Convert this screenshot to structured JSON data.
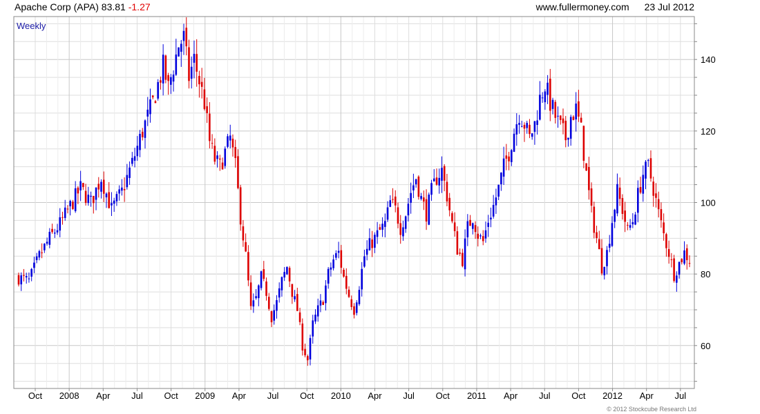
{
  "header": {
    "name": "Apache Corp (APA)",
    "price": "83.81",
    "change": "-1.27",
    "site": "www.fullermoney.com",
    "date": "23 Jul 2012"
  },
  "footer": {
    "copyright": "© 2012 Stockcube Research Ltd"
  },
  "colors": {
    "up": "#0000dd",
    "down": "#dd0000",
    "grid": "#dddddd",
    "frame": "#888888",
    "period_label": "#1a1aa6"
  },
  "chart_data": {
    "type": "candlestick",
    "period_label": "Weekly",
    "ylim": [
      48,
      152
    ],
    "yticks": [
      60,
      80,
      100,
      120,
      140
    ],
    "x_tick_labels": [
      "Oct",
      "2008",
      "Apr",
      "Jul",
      "Oct",
      "2009",
      "Apr",
      "Jul",
      "Oct",
      "2010",
      "Apr",
      "Jul",
      "Oct",
      "2011",
      "Apr",
      "Jul",
      "Oct",
      "2012",
      "Apr",
      "Jul"
    ],
    "series_close": [
      [
        0,
        79
      ],
      [
        4,
        78
      ],
      [
        8,
        85
      ],
      [
        12,
        90
      ],
      [
        16,
        94
      ],
      [
        20,
        99
      ],
      [
        24,
        104
      ],
      [
        28,
        100
      ],
      [
        32,
        107
      ],
      [
        36,
        98
      ],
      [
        40,
        103
      ],
      [
        44,
        111
      ],
      [
        48,
        120
      ],
      [
        52,
        128
      ],
      [
        56,
        138
      ],
      [
        58,
        132
      ],
      [
        62,
        144
      ],
      [
        64,
        146
      ],
      [
        66,
        135
      ],
      [
        68,
        140
      ],
      [
        70,
        134
      ],
      [
        72,
        128
      ],
      [
        74,
        117
      ],
      [
        76,
        112
      ],
      [
        78,
        110
      ],
      [
        80,
        114
      ],
      [
        82,
        118
      ],
      [
        84,
        110
      ],
      [
        86,
        96
      ],
      [
        88,
        85
      ],
      [
        90,
        70
      ],
      [
        92,
        73
      ],
      [
        94,
        79
      ],
      [
        96,
        75
      ],
      [
        98,
        68
      ],
      [
        100,
        72
      ],
      [
        102,
        78
      ],
      [
        104,
        82
      ],
      [
        106,
        75
      ],
      [
        108,
        70
      ],
      [
        110,
        60
      ],
      [
        112,
        56
      ],
      [
        114,
        66
      ],
      [
        116,
        70
      ],
      [
        118,
        73
      ],
      [
        120,
        80
      ],
      [
        122,
        84
      ],
      [
        124,
        86
      ],
      [
        126,
        79
      ],
      [
        128,
        74
      ],
      [
        130,
        70
      ],
      [
        132,
        77
      ],
      [
        134,
        85
      ],
      [
        136,
        88
      ],
      [
        138,
        90
      ],
      [
        140,
        92
      ],
      [
        142,
        94
      ],
      [
        144,
        100
      ],
      [
        146,
        98
      ],
      [
        148,
        93
      ],
      [
        150,
        97
      ],
      [
        152,
        103
      ],
      [
        154,
        107
      ],
      [
        156,
        101
      ],
      [
        158,
        97
      ],
      [
        160,
        103
      ],
      [
        162,
        107
      ],
      [
        164,
        109
      ],
      [
        166,
        102
      ],
      [
        168,
        94
      ],
      [
        170,
        87
      ],
      [
        172,
        84
      ],
      [
        174,
        93
      ],
      [
        176,
        96
      ],
      [
        178,
        91
      ],
      [
        180,
        89
      ],
      [
        182,
        95
      ],
      [
        184,
        99
      ],
      [
        186,
        104
      ],
      [
        188,
        110
      ],
      [
        190,
        114
      ],
      [
        192,
        120
      ],
      [
        194,
        125
      ],
      [
        196,
        122
      ],
      [
        198,
        118
      ],
      [
        200,
        122
      ],
      [
        202,
        129
      ],
      [
        204,
        133
      ],
      [
        206,
        128
      ],
      [
        208,
        124
      ],
      [
        210,
        121
      ],
      [
        212,
        118
      ],
      [
        214,
        124
      ],
      [
        216,
        126
      ],
      [
        218,
        120
      ],
      [
        220,
        108
      ],
      [
        222,
        97
      ],
      [
        224,
        90
      ],
      [
        226,
        82
      ],
      [
        228,
        86
      ],
      [
        230,
        95
      ],
      [
        232,
        103
      ],
      [
        234,
        98
      ],
      [
        236,
        92
      ],
      [
        238,
        95
      ],
      [
        240,
        102
      ],
      [
        242,
        108
      ],
      [
        244,
        110
      ],
      [
        246,
        104
      ],
      [
        248,
        97
      ],
      [
        250,
        91
      ],
      [
        252,
        86
      ],
      [
        254,
        80
      ],
      [
        256,
        83
      ],
      [
        258,
        86
      ],
      [
        260,
        84
      ]
    ]
  }
}
